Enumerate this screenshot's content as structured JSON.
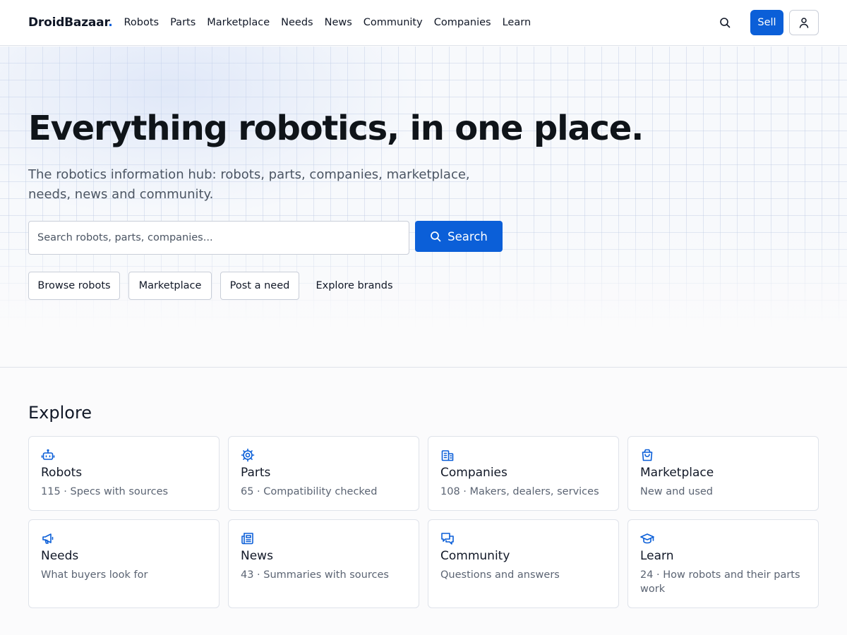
{
  "header": {
    "logo": "DroidBazaar",
    "logo_dot": ".",
    "nav": [
      "Robots",
      "Parts",
      "Marketplace",
      "Needs",
      "News",
      "Community",
      "Companies",
      "Learn"
    ],
    "sell_label": "Sell",
    "icons": {
      "search": "search-icon",
      "user": "user-icon"
    }
  },
  "hero": {
    "title": "Everything robotics, in one place.",
    "subtitle": "The robotics information hub: robots, parts, companies, marketplace, needs, news and community.",
    "search_placeholder": "Search robots, parts, companies...",
    "search_button": "Search",
    "chips": [
      "Browse robots",
      "Marketplace",
      "Post a need",
      "Explore brands"
    ]
  },
  "explore": {
    "title": "Explore",
    "cards": [
      {
        "title": "Robots",
        "desc": "115 · Specs with sources",
        "icon": "robot-icon"
      },
      {
        "title": "Parts",
        "desc": "65 · Compatibility checked",
        "icon": "gear-icon"
      },
      {
        "title": "Companies",
        "desc": "108 · Makers, dealers, services",
        "icon": "building-icon"
      },
      {
        "title": "Marketplace",
        "desc": "New and used",
        "icon": "shopping-bag-icon"
      },
      {
        "title": "Needs",
        "desc": "What buyers look for",
        "icon": "megaphone-icon"
      },
      {
        "title": "News",
        "desc": "43 · Summaries with sources",
        "icon": "newspaper-icon"
      },
      {
        "title": "Community",
        "desc": "Questions and answers",
        "icon": "chat-icon"
      },
      {
        "title": "Learn",
        "desc": "24 · How robots and their parts work",
        "icon": "graduation-cap-icon"
      }
    ]
  },
  "colors": {
    "accent": "#0b5fd8",
    "text": "#111827",
    "muted": "#5b6473",
    "border": "#dfe3ea"
  }
}
